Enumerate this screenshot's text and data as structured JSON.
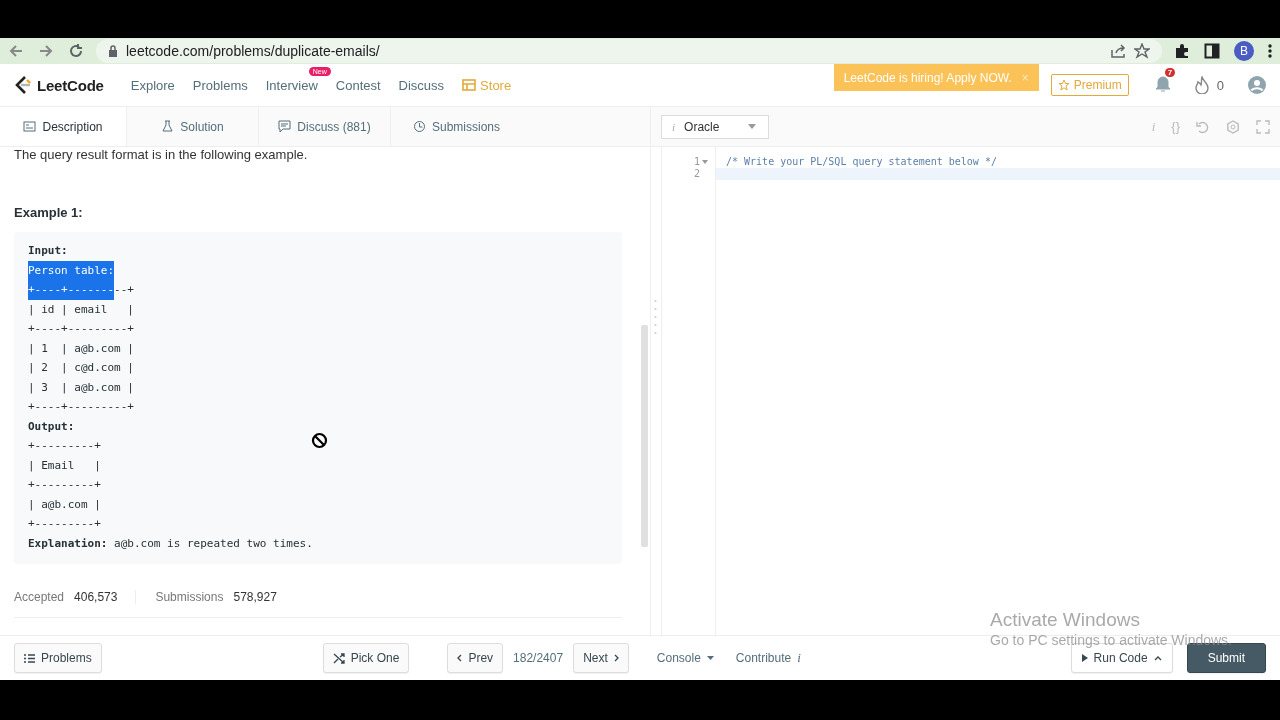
{
  "browser": {
    "url": "leetcode.com/problems/duplicate-emails/",
    "profile_initial": "B"
  },
  "nav": {
    "brand": "LeetCode",
    "links": [
      {
        "label": "Explore",
        "kind": "plain"
      },
      {
        "label": "Problems",
        "kind": "plain"
      },
      {
        "label": "Interview",
        "kind": "plain",
        "badge": "New"
      },
      {
        "label": "Contest",
        "kind": "plain"
      },
      {
        "label": "Discuss",
        "kind": "plain"
      },
      {
        "label": "Store",
        "kind": "store"
      }
    ],
    "banner": {
      "text": "LeetCode is hiring! Apply NOW.",
      "close": "×"
    },
    "premium": "Premium",
    "notifications": "7",
    "streak": "0"
  },
  "tabs": [
    {
      "label": "Description",
      "kind": "description",
      "selected": true
    },
    {
      "label": "Solution",
      "kind": "solution",
      "selected": false
    },
    {
      "label": "Discuss (881)",
      "kind": "discuss",
      "selected": false
    },
    {
      "label": "Submissions",
      "kind": "submissions",
      "selected": false
    }
  ],
  "description": {
    "intro": "The query result format is in the following example.",
    "example_title": "Example 1:",
    "code_lines": [
      {
        "segments": [
          {
            "text": "**Input:**",
            "selected": false
          }
        ]
      },
      {
        "segments": [
          {
            "text": "Person table:",
            "selected": true
          }
        ]
      },
      {
        "segments": [
          {
            "text": "+----+-------",
            "selected": true
          },
          {
            "text": "--+",
            "selected": false
          }
        ]
      },
      {
        "segments": [
          {
            "text": "| id | email   |",
            "selected": false
          }
        ]
      },
      {
        "segments": [
          {
            "text": "+----+---------+",
            "selected": false
          }
        ]
      },
      {
        "segments": [
          {
            "text": "| 1  | a@b.com |",
            "selected": false
          }
        ]
      },
      {
        "segments": [
          {
            "text": "| 2  | c@d.com |",
            "selected": false
          }
        ]
      },
      {
        "segments": [
          {
            "text": "| 3  | a@b.com |",
            "selected": false
          }
        ]
      },
      {
        "segments": [
          {
            "text": "+----+---------+",
            "selected": false
          }
        ]
      },
      {
        "segments": [
          {
            "text": "**Output:**",
            "selected": false
          }
        ]
      },
      {
        "segments": [
          {
            "text": "+---------+",
            "selected": false
          }
        ]
      },
      {
        "segments": [
          {
            "text": "| Email   |",
            "selected": false
          }
        ]
      },
      {
        "segments": [
          {
            "text": "+---------+",
            "selected": false
          }
        ]
      },
      {
        "segments": [
          {
            "text": "| a@b.com |",
            "selected": false
          }
        ]
      },
      {
        "segments": [
          {
            "text": "+---------+",
            "selected": false
          }
        ]
      },
      {
        "segments": [
          {
            "text": "**Explanation:** a@b.com is repeated two times.",
            "selected": false
          }
        ]
      }
    ],
    "stats": [
      {
        "label": "Accepted",
        "value": "406,573"
      },
      {
        "label": "Submissions",
        "value": "578,927"
      }
    ]
  },
  "editor": {
    "language": "Oracle",
    "language_mark": "i",
    "tools": [
      {
        "kind": "info",
        "label": "i"
      },
      {
        "kind": "format",
        "label": "{}"
      },
      {
        "kind": "reset"
      },
      {
        "kind": "settings"
      },
      {
        "kind": "fullscreen"
      }
    ],
    "lines": [
      {
        "number": "1",
        "text": "/* Write your PL/SQL query statement below */",
        "foldable": true,
        "active": false
      },
      {
        "number": "2",
        "foldable": false,
        "active": true
      }
    ]
  },
  "footer": {
    "problems": "Problems",
    "pick_one": "Pick One",
    "prev": "Prev",
    "position": "182/2407",
    "next": "Next",
    "console": "Console",
    "contribute": "Contribute",
    "contribute_mark": "i",
    "run_code": "Run Code",
    "submit": "Submit"
  },
  "os_overlay": {
    "title": "Activate Windows",
    "subtitle": "Go to PC settings to activate Windows."
  }
}
